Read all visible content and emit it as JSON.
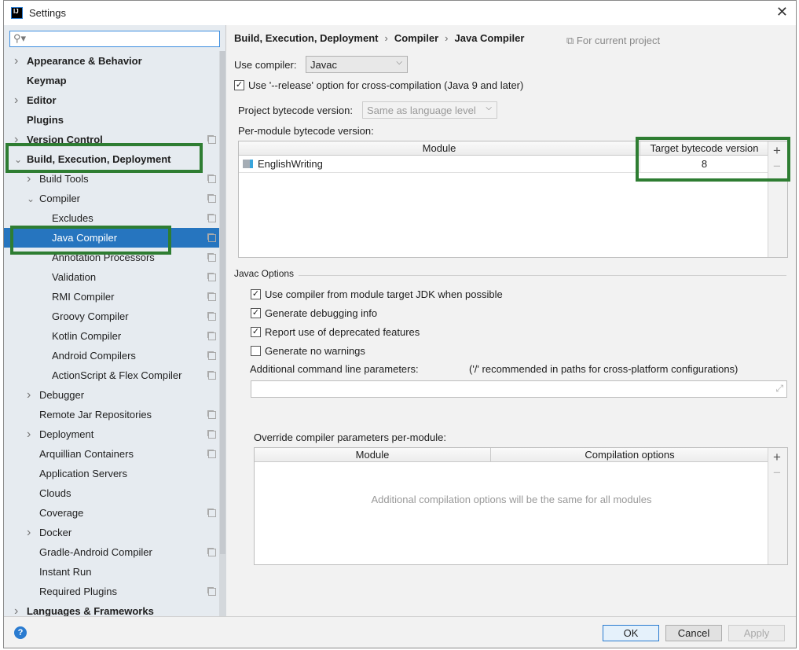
{
  "window": {
    "title": "Settings",
    "logo": "IJ"
  },
  "sidebar": {
    "search_placeholder": "",
    "items": [
      {
        "label": "Appearance & Behavior",
        "level": 0,
        "bold": true,
        "arrow": "right",
        "copy": false
      },
      {
        "label": "Keymap",
        "level": 0,
        "bold": true,
        "arrow": "",
        "copy": false
      },
      {
        "label": "Editor",
        "level": 0,
        "bold": true,
        "arrow": "right",
        "copy": false
      },
      {
        "label": "Plugins",
        "level": 0,
        "bold": true,
        "arrow": "",
        "copy": false
      },
      {
        "label": "Version Control",
        "level": 0,
        "bold": true,
        "arrow": "right",
        "copy": true
      },
      {
        "label": "Build, Execution, Deployment",
        "level": 0,
        "bold": true,
        "arrow": "down",
        "copy": false
      },
      {
        "label": "Build Tools",
        "level": 1,
        "arrow": "right",
        "copy": true
      },
      {
        "label": "Compiler",
        "level": 1,
        "arrow": "down",
        "copy": true
      },
      {
        "label": "Excludes",
        "level": 2,
        "arrow": "",
        "copy": true
      },
      {
        "label": "Java Compiler",
        "level": 2,
        "arrow": "",
        "copy": true,
        "selected": true
      },
      {
        "label": "Annotation Processors",
        "level": 2,
        "arrow": "",
        "copy": true
      },
      {
        "label": "Validation",
        "level": 2,
        "arrow": "",
        "copy": true
      },
      {
        "label": "RMI Compiler",
        "level": 2,
        "arrow": "",
        "copy": true
      },
      {
        "label": "Groovy Compiler",
        "level": 2,
        "arrow": "",
        "copy": true
      },
      {
        "label": "Kotlin Compiler",
        "level": 2,
        "arrow": "",
        "copy": true
      },
      {
        "label": "Android Compilers",
        "level": 2,
        "arrow": "",
        "copy": true
      },
      {
        "label": "ActionScript & Flex Compiler",
        "level": 2,
        "arrow": "",
        "copy": true
      },
      {
        "label": "Debugger",
        "level": 1,
        "arrow": "right",
        "copy": false
      },
      {
        "label": "Remote Jar Repositories",
        "level": 1,
        "arrow": "",
        "copy": true
      },
      {
        "label": "Deployment",
        "level": 1,
        "arrow": "right",
        "copy": true
      },
      {
        "label": "Arquillian Containers",
        "level": 1,
        "arrow": "",
        "copy": true
      },
      {
        "label": "Application Servers",
        "level": 1,
        "arrow": "",
        "copy": false
      },
      {
        "label": "Clouds",
        "level": 1,
        "arrow": "",
        "copy": false
      },
      {
        "label": "Coverage",
        "level": 1,
        "arrow": "",
        "copy": true
      },
      {
        "label": "Docker",
        "level": 1,
        "arrow": "right",
        "copy": false
      },
      {
        "label": "Gradle-Android Compiler",
        "level": 1,
        "arrow": "",
        "copy": true
      },
      {
        "label": "Instant Run",
        "level": 1,
        "arrow": "",
        "copy": false
      },
      {
        "label": "Required Plugins",
        "level": 1,
        "arrow": "",
        "copy": true
      },
      {
        "label": "Languages & Frameworks",
        "level": 0,
        "bold": true,
        "arrow": "right",
        "copy": false
      }
    ]
  },
  "main": {
    "breadcrumb": [
      "Build, Execution, Deployment",
      "Compiler",
      "Java Compiler"
    ],
    "for_current_project": "For current project",
    "use_compiler_label": "Use compiler:",
    "use_compiler_value": "Javac",
    "release_option": {
      "label": "Use '--release' option for cross-compilation (Java 9 and later)",
      "checked": true
    },
    "project_bytecode_label": "Project bytecode version:",
    "project_bytecode_value": "Same as language level",
    "per_module_label": "Per-module bytecode version:",
    "module_table": {
      "headers": [
        "Module",
        "Target bytecode version"
      ],
      "rows": [
        {
          "module": "EnglishWriting",
          "version": "8"
        }
      ]
    },
    "javac_options": {
      "title": "Javac Options",
      "checkboxes": [
        {
          "label": "Use compiler from module target JDK when possible",
          "checked": true
        },
        {
          "label": "Generate debugging info",
          "checked": true
        },
        {
          "label": "Report use of deprecated features",
          "checked": true
        },
        {
          "label": "Generate no warnings",
          "checked": false
        }
      ],
      "additional_label": "Additional command line parameters:",
      "additional_hint": "('/' recommended in paths for cross-platform configurations)",
      "additional_value": ""
    },
    "override_label": "Override compiler parameters per-module:",
    "override_table": {
      "headers": [
        "Module",
        "Compilation options"
      ],
      "empty_text": "Additional compilation options will be the same for all modules"
    }
  },
  "buttons": {
    "ok": "OK",
    "cancel": "Cancel",
    "apply": "Apply",
    "help": "?"
  },
  "colors": {
    "selection": "#2675bf",
    "highlight_box": "#2e7d32"
  }
}
